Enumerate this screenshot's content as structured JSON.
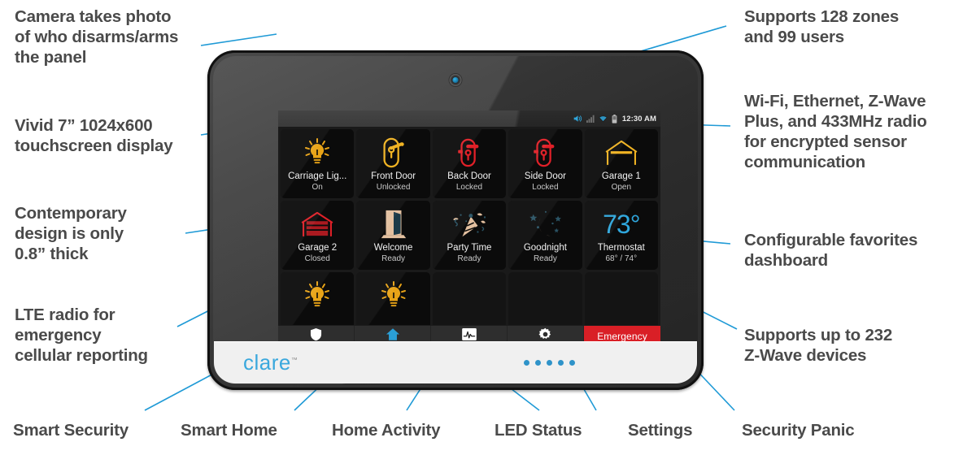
{
  "callouts": {
    "left": [
      {
        "id": "camera-photo",
        "text": "Camera takes photo\nof who disarms/arms\nthe panel"
      },
      {
        "id": "display",
        "text": "Vivid 7” 1024x600\ntouchscreen display"
      },
      {
        "id": "design",
        "text": "Contemporary\ndesign is only\n0.8” thick"
      },
      {
        "id": "lte",
        "text": "LTE radio for\nemergency\ncellular reporting"
      }
    ],
    "right": [
      {
        "id": "zones-users",
        "text": "Supports 128 zones\nand 99 users"
      },
      {
        "id": "radios",
        "text": "Wi-Fi, Ethernet, Z-Wave\nPlus, and 433MHz radio\nfor encrypted sensor\ncommunication"
      },
      {
        "id": "favorites",
        "text": "Configurable favorites\ndashboard"
      },
      {
        "id": "zwave-devices",
        "text": "Supports up to 232\nZ-Wave devices"
      }
    ],
    "bottom": [
      {
        "id": "smart-security",
        "text": "Smart Security"
      },
      {
        "id": "smart-home",
        "text": "Smart Home"
      },
      {
        "id": "home-activity",
        "text": "Home Activity"
      },
      {
        "id": "led-status",
        "text": "LED Status"
      },
      {
        "id": "settings",
        "text": "Settings"
      },
      {
        "id": "security-panic",
        "text": "Security Panic"
      }
    ]
  },
  "device": {
    "brand": "clare",
    "trademark": "™",
    "led_count": 5
  },
  "screen": {
    "statusbar": {
      "time": "12:30 AM",
      "icons": [
        "volume-icon",
        "signal-icon",
        "wifi-icon",
        "battery-icon"
      ]
    },
    "tiles": [
      {
        "name": "Carriage Lig...",
        "state": "On",
        "icon": "lightbulb-icon",
        "color": "#e8a317"
      },
      {
        "name": "Front Door",
        "state": "Unlocked",
        "icon": "lock-unlocked-icon",
        "color": "#f0b323"
      },
      {
        "name": "Back Door",
        "state": "Locked",
        "icon": "lock-locked-icon",
        "color": "#e02028"
      },
      {
        "name": "Side Door",
        "state": "Locked",
        "icon": "lock-locked-icon",
        "color": "#e02028"
      },
      {
        "name": "Garage 1",
        "state": "Open",
        "icon": "garage-open-icon",
        "color": "#f0b323"
      },
      {
        "name": "Garage 2",
        "state": "Closed",
        "icon": "garage-closed-icon",
        "color": "#e02028"
      },
      {
        "name": "Welcome",
        "state": "Ready",
        "icon": "open-door-icon",
        "color": "#e3c0a0"
      },
      {
        "name": "Party Time",
        "state": "Ready",
        "icon": "party-popper-icon",
        "color": "#e3c0a0"
      },
      {
        "name": "Goodnight",
        "state": "Ready",
        "icon": "crescent-moon-icon",
        "color": "#e3c0a0"
      },
      {
        "name": "Thermostat",
        "state": "68° / 74°",
        "icon": "thermostat-temp",
        "value": "73°",
        "color": "#2fa7dd"
      },
      {
        "name": "",
        "state": "",
        "icon": "lightbulb-icon",
        "color": "#e8a317"
      },
      {
        "name": "",
        "state": "",
        "icon": "lightbulb-icon",
        "color": "#e8a317"
      }
    ],
    "navbar": [
      {
        "id": "security",
        "icon": "shield-icon",
        "label": ""
      },
      {
        "id": "home",
        "icon": "home-icon",
        "label": ""
      },
      {
        "id": "activity",
        "icon": "activity-chart-icon",
        "label": ""
      },
      {
        "id": "settings",
        "icon": "gear-icon",
        "label": ""
      },
      {
        "id": "emergency",
        "icon": "",
        "label": "Emergency"
      }
    ]
  },
  "colors": {
    "accent_blue": "#1f9ad6",
    "text_gray": "#4a4a4a",
    "emergency_red": "#d91f26",
    "brand_blue": "#3aa8dd"
  }
}
